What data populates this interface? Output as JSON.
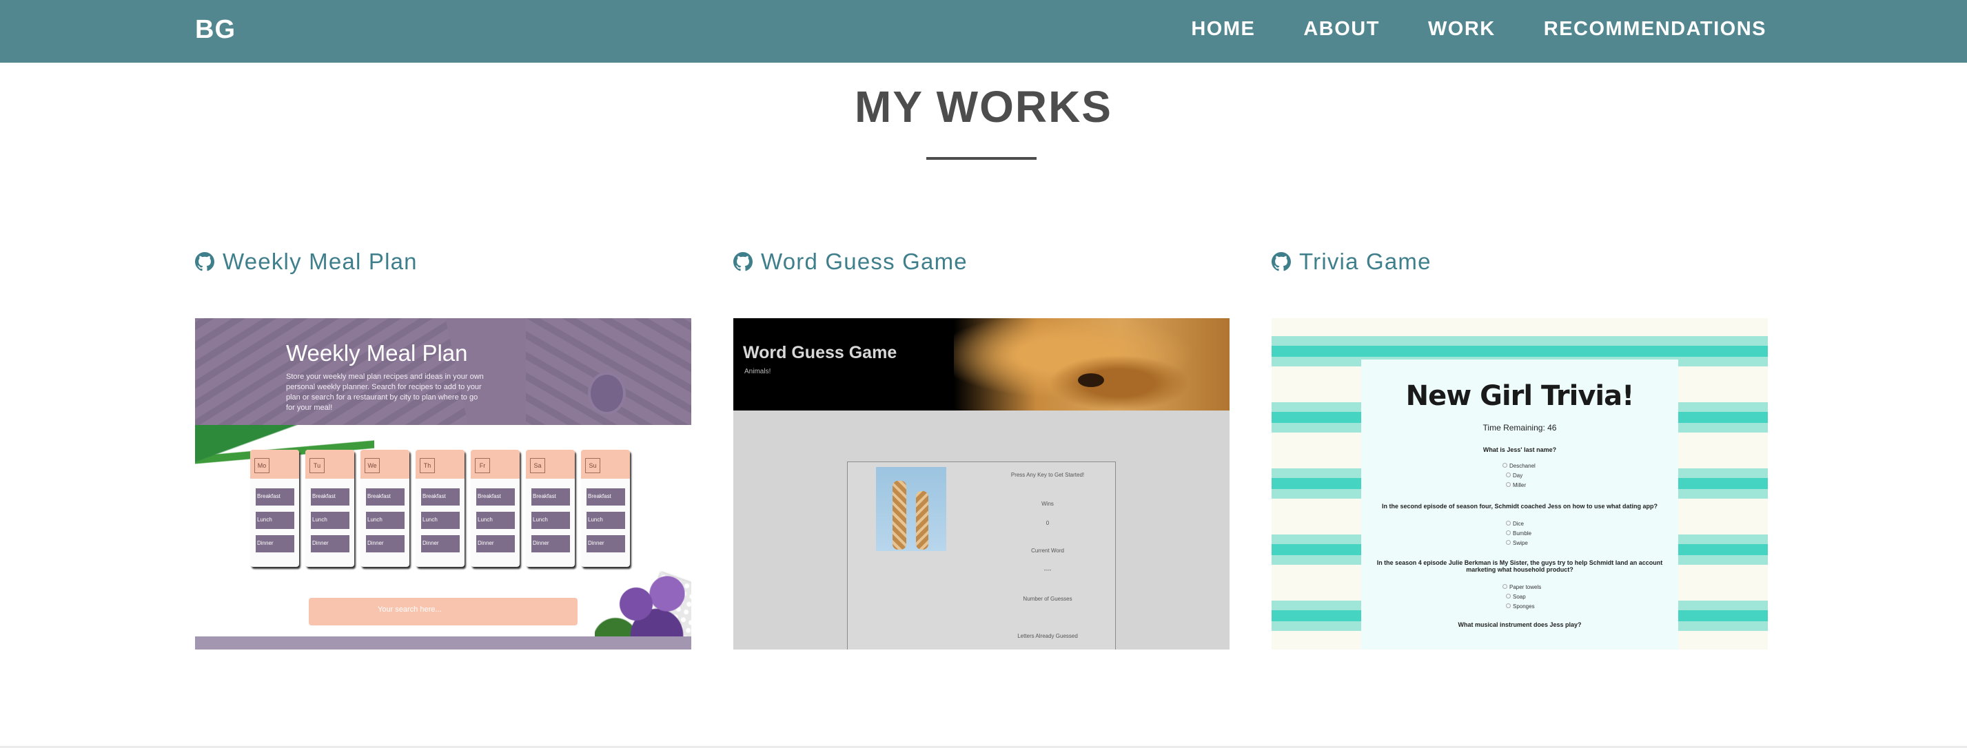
{
  "brand": "BG",
  "nav": {
    "items": [
      "HOME",
      "ABOUT",
      "WORK",
      "RECOMMENDATIONS"
    ]
  },
  "section": {
    "title": "MY WORKS"
  },
  "projects": [
    {
      "name": "Weekly Meal Plan",
      "icon": "github-icon",
      "thumb": {
        "title": "Weekly Meal Plan",
        "subtitle": "Store your weekly meal plan recipes and ideas in your own personal weekly planner. Search for recipes to add to your plan or search for a restaurant by city to plan where to go for your meal!",
        "days": [
          "Mo",
          "Tu",
          "We",
          "Th",
          "Fr",
          "Sa",
          "Su"
        ],
        "meals": [
          "Breakfast",
          "Lunch",
          "Dinner"
        ],
        "search_placeholder": "Your search here..."
      }
    },
    {
      "name": "Word Guess Game",
      "icon": "github-icon",
      "thumb": {
        "title": "Word Guess Game",
        "subtitle": "Animals!",
        "lines": [
          "Press Any Key to Get Started!",
          "Wins",
          "0",
          "Current Word",
          "----",
          "Number of Guesses",
          "Letters Already Guessed"
        ]
      }
    },
    {
      "name": "Trivia Game",
      "icon": "github-icon",
      "thumb": {
        "title": "New Girl Trivia!",
        "time": "Time Remaining: 46",
        "q1": "What is Jess' last name?",
        "q1_opts": [
          "Deschanel",
          "Day",
          "Miller"
        ],
        "q2": "In the second episode of season four, Schmidt coached Jess on how to use what dating app?",
        "q2_opts": [
          "Dice",
          "Bumble",
          "Swipe"
        ],
        "q3": "In the season 4 episode Julie Berkman is My Sister, the guys try to help Schmidt land an account marketing what household product?",
        "q3_opts": [
          "Paper towels",
          "Soap",
          "Sponges"
        ],
        "q4": "What musical instrument does Jess play?"
      }
    }
  ],
  "colors": {
    "navbar": "#528790",
    "link": "#3f7f8c",
    "heading": "#4d4d4d"
  }
}
